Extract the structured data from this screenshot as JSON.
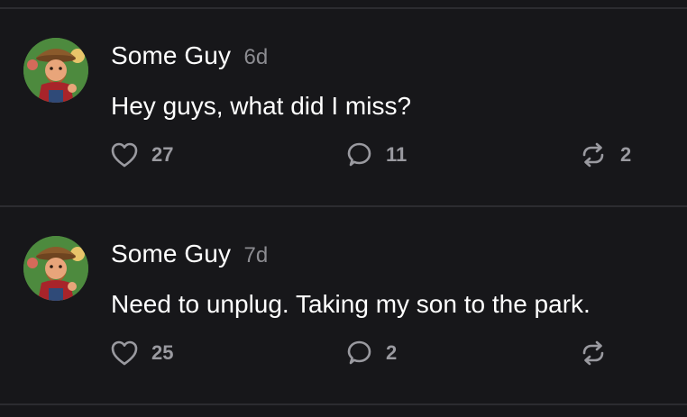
{
  "posts": [
    {
      "author": "Some Guy",
      "age": "6d",
      "text": "Hey guys, what did I miss?",
      "likes": "27",
      "replies": "11",
      "reposts": "2"
    },
    {
      "author": "Some Guy",
      "age": "7d",
      "text": "Need to unplug. Taking my son to the park.",
      "likes": "25",
      "replies": "2",
      "reposts": ""
    }
  ],
  "icons": {
    "like": "heart-icon",
    "reply": "speech-bubble-icon",
    "repost": "repost-arrows-icon"
  },
  "colors": {
    "background": "#17171a",
    "divider": "#2c2c30",
    "text": "#ffffff",
    "muted": "#8c8c91",
    "action": "#9a9aa0"
  }
}
